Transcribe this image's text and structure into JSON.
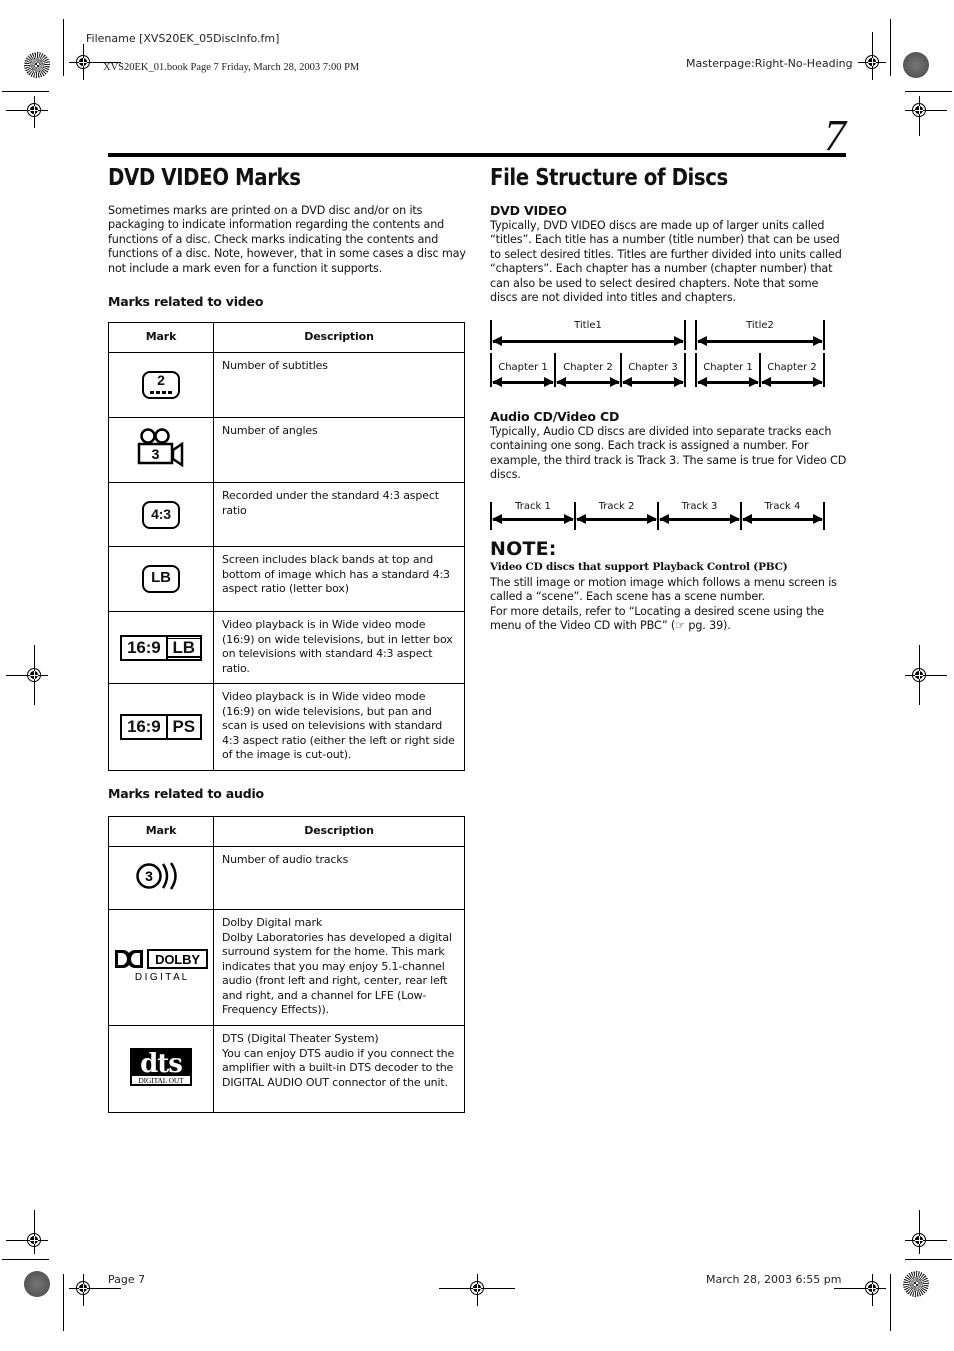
{
  "header": {
    "filename": "Filename [XVS20EK_05DiscInfo.fm]",
    "book_info": "XVS20EK_01.book  Page 7  Friday, March 28, 2003  7:00 PM",
    "masterpage": "Masterpage:Right-No-Heading",
    "page_number": "7"
  },
  "left": {
    "title": "DVD VIDEO Marks",
    "intro": "Sometimes marks are printed on a DVD disc and/or on its packaging to indicate information regarding the contents and functions of a disc. Check marks indicating the contents and functions of a disc. Note, however, that in some cases a disc may not include a mark even for a function it supports.",
    "video_heading": "Marks related to video",
    "audio_heading": "Marks related to audio",
    "col_mark": "Mark",
    "col_description": "Description",
    "video_rows": [
      {
        "icon": "subtitles-2",
        "icon_text": "2",
        "description": "Number of subtitles"
      },
      {
        "icon": "angles-3",
        "icon_text": "3",
        "description": "Number of angles"
      },
      {
        "icon": "aspect-4-3",
        "icon_text": "4:3",
        "description": "Recorded under the standard 4:3 aspect ratio"
      },
      {
        "icon": "letterbox",
        "icon_text": "LB",
        "description": "Screen includes black bands at top and bottom of image which has a standard 4:3 aspect ratio (letter box)"
      },
      {
        "icon": "wide-lb",
        "icon_text_a": "16:9",
        "icon_text_b": "LB",
        "description": "Video playback is in Wide video mode (16:9) on wide televisions, but in letter box on televisions with standard 4:3 aspect ratio."
      },
      {
        "icon": "wide-ps",
        "icon_text_a": "16:9",
        "icon_text_b": "PS",
        "description": "Video playback is in Wide video mode (16:9) on wide televisions, but pan and scan is used on televisions with standard 4:3 aspect ratio (either the left or right side of the image is cut-out)."
      }
    ],
    "audio_rows": [
      {
        "icon": "audio-tracks-3",
        "icon_text": "3",
        "description": "Number of audio tracks"
      },
      {
        "icon": "dolby-digital",
        "icon_text_a": "DOLBY",
        "icon_text_b": "D I G I T A L",
        "description_title": "Dolby Digital mark",
        "description": "Dolby Laboratories has developed a digital surround system for the home. This mark indicates that you may enjoy 5.1-channel audio (front left and right, center, rear left and right, and a channel for LFE (Low-Frequency Effects))."
      },
      {
        "icon": "dts-digital-out",
        "icon_text_a": "dts",
        "icon_text_b": "DIGITAL OUT",
        "description_title": "DTS (Digital Theater System)",
        "description": "You can enjoy DTS audio if you connect the amplifier with a built-in DTS decoder to the DIGITAL AUDIO OUT connector of the unit."
      }
    ]
  },
  "right": {
    "title": "File Structure of Discs",
    "dvd_heading": "DVD VIDEO",
    "dvd_text": "Typically, DVD VIDEO discs are made up of larger units called “titles”. Each title has a number (title number) that can be used to select desired titles. Titles are further divided into units called “chapters”. Each chapter has a number (chapter number) that can also be used to select desired chapters. Note that some discs are not divided into titles and chapters.",
    "dvd_diagram": {
      "titles": [
        "Title1",
        "Title2"
      ],
      "chapters_title1": [
        "Chapter 1",
        "Chapter 2",
        "Chapter 3"
      ],
      "chapters_title2": [
        "Chapter 1",
        "Chapter 2"
      ]
    },
    "cd_heading": "Audio CD/Video CD",
    "cd_text": "Typically, Audio CD discs are divided into separate tracks each containing one song. Each track is assigned a number. For example, the third track is Track 3. The same is true for Video CD discs.",
    "cd_diagram": {
      "tracks": [
        "Track 1",
        "Track 2",
        "Track 3",
        "Track 4"
      ]
    },
    "note": {
      "title": "NOTE:",
      "subtitle": "Video CD discs that support Playback Control (PBC)",
      "text1": "The still image or motion image which follows a menu screen is called a “scene”. Each scene has a scene number.",
      "text2": "For more details, refer to “Locating a desired scene using the menu of the Video CD with PBC” (☞ pg. 39)."
    }
  },
  "footer": {
    "page_label": "Page 7",
    "timestamp": "March 28, 2003 6:55 pm"
  }
}
